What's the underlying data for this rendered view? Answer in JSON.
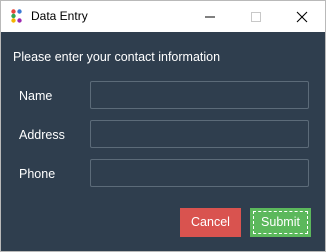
{
  "window": {
    "title": "Data Entry",
    "controls": {
      "minimize_icon": "minimize-icon",
      "maximize_icon": "maximize-icon",
      "close_icon": "close-icon"
    }
  },
  "form": {
    "prompt": "Please enter your contact information",
    "fields": [
      {
        "label": "Name",
        "value": "",
        "placeholder": ""
      },
      {
        "label": "Address",
        "value": "",
        "placeholder": ""
      },
      {
        "label": "Phone",
        "value": "",
        "placeholder": ""
      }
    ],
    "buttons": {
      "cancel_label": "Cancel",
      "submit_label": "Submit"
    }
  },
  "colors": {
    "background": "#2f3e4e",
    "titlebar": "#ffffff",
    "input_border": "#5c6b79",
    "cancel": "#d9534f",
    "submit": "#5cb85c",
    "text": "#ffffff"
  }
}
